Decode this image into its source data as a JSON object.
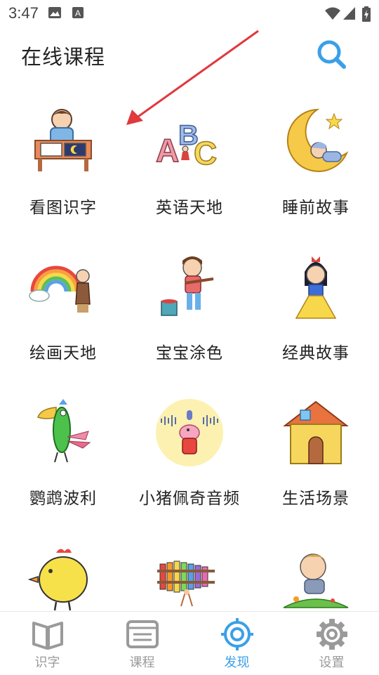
{
  "status_bar": {
    "time": "3:47"
  },
  "header": {
    "title": "在线课程",
    "search_icon": "search-icon"
  },
  "courses": [
    {
      "label": "看图识字",
      "icon": "boy-reading-book-icon"
    },
    {
      "label": "英语天地",
      "icon": "abc-letters-icon"
    },
    {
      "label": "睡前故事",
      "icon": "moon-sleeping-baby-icon"
    },
    {
      "label": "绘画天地",
      "icon": "rainbow-painter-icon"
    },
    {
      "label": "宝宝涂色",
      "icon": "girl-painting-icon"
    },
    {
      "label": "经典故事",
      "icon": "princess-icon"
    },
    {
      "label": "鹦鹉波利",
      "icon": "parrot-icon"
    },
    {
      "label": "小猪佩奇音频",
      "icon": "peppa-pig-audio-icon"
    },
    {
      "label": "生活场景",
      "icon": "house-icon"
    },
    {
      "label": "",
      "icon": "chick-icon"
    },
    {
      "label": "",
      "icon": "xylophone-icon"
    },
    {
      "label": "",
      "icon": "boy-on-grass-icon"
    }
  ],
  "bottom_nav": [
    {
      "label": "识字",
      "icon": "open-book-icon",
      "active": false
    },
    {
      "label": "课程",
      "icon": "course-list-icon",
      "active": false
    },
    {
      "label": "发现",
      "icon": "discover-target-icon",
      "active": true
    },
    {
      "label": "设置",
      "icon": "gear-icon",
      "active": false
    }
  ],
  "colors": {
    "accent": "#3aa0e8",
    "inactive": "#9a9a9a",
    "arrow": "#e0393e"
  }
}
